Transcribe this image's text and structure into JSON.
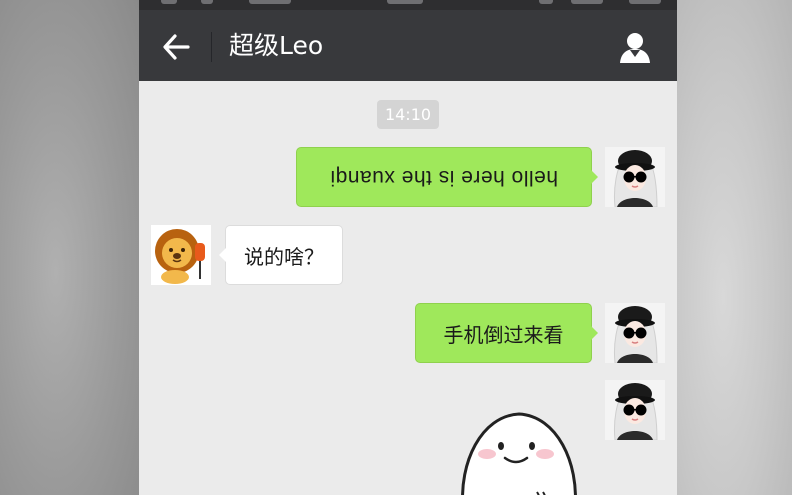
{
  "chat": {
    "title": "超级Leo",
    "timestamp": "14:10"
  },
  "messages": [
    {
      "sender": "me",
      "type": "text",
      "text": "hello  here is the xuanqi",
      "display": "upside-down"
    },
    {
      "sender": "other",
      "type": "text",
      "text": "说的啥？"
    },
    {
      "sender": "me",
      "type": "text",
      "text": "手机倒过来看"
    },
    {
      "sender": "me",
      "type": "sticker",
      "sticker": "smiling-dumpling-sticker"
    }
  ],
  "icons": {
    "back": "back-arrow-icon",
    "profile": "person-icon"
  },
  "colors": {
    "navbar": "#38393c",
    "chat_background": "#ebebeb",
    "bubble_sent": "#9fe85b",
    "bubble_received": "#ffffff",
    "timestamp_badge": "#d4d4d4"
  }
}
